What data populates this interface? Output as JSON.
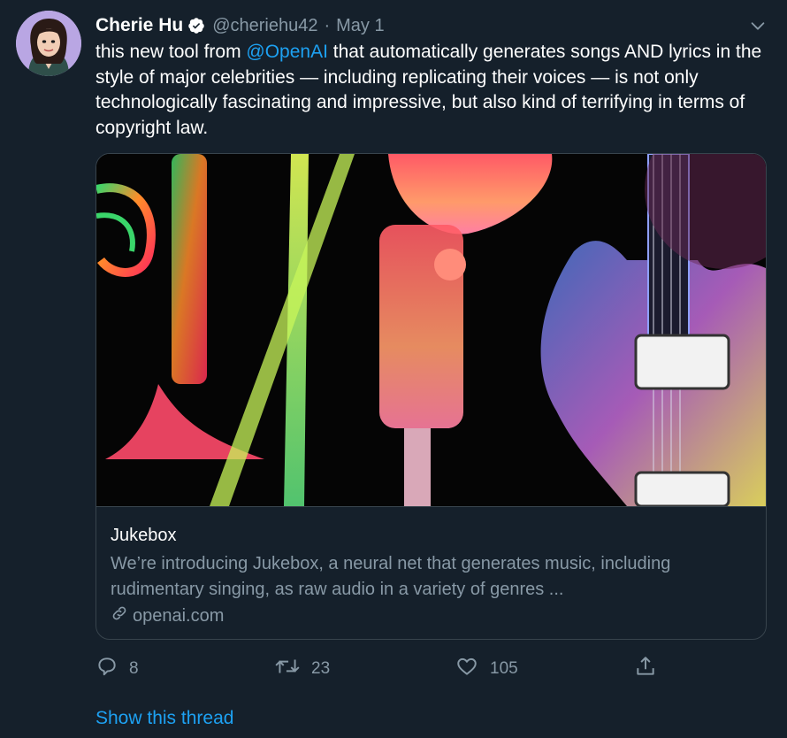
{
  "tweet": {
    "author_name": "Cherie Hu",
    "handle": "@cheriehu42",
    "separator": "·",
    "date": "May 1",
    "text_before": "this new tool from ",
    "mention": "@OpenAI",
    "text_after": " that automatically generates songs AND lyrics in the style of major celebrities — including replicating their voices — is not only technologically fascinating and impressive, but also kind of terrifying in terms of copyright law."
  },
  "card": {
    "title": "Jukebox",
    "description": "We’re introducing Jukebox, a neural net that generates music, including rudimentary singing, as raw audio in a variety of genres ...",
    "domain": "openai.com"
  },
  "actions": {
    "replies": "8",
    "retweets": "23",
    "likes": "105"
  },
  "thread_link": "Show this thread",
  "colors": {
    "background": "#15202b",
    "accent": "#1da1f2",
    "secondary_text": "#8899a6",
    "border": "#38444d"
  },
  "icons": [
    "verified-badge-icon",
    "chevron-down-icon",
    "link-icon",
    "reply-icon",
    "retweet-icon",
    "like-icon",
    "share-icon"
  ]
}
